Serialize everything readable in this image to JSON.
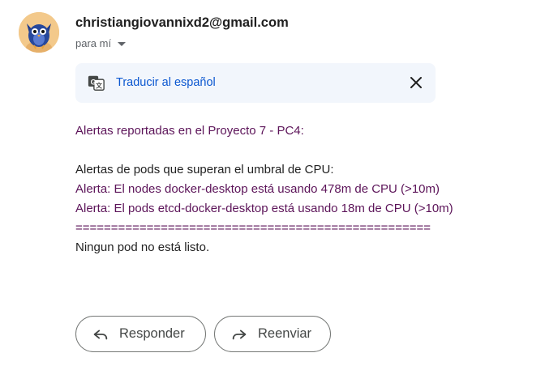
{
  "email": {
    "sender": "christiangiovannixd2@gmail.com",
    "recipient_label": "para mí"
  },
  "translate": {
    "label": "Traducir al español",
    "icon": "translate-icon",
    "close_icon": "close-icon"
  },
  "body": {
    "heading": "Alertas reportadas en el Proyecto 7 - PC4:",
    "subheading": "Alertas de pods que superan el umbral de CPU:",
    "alert1": "Alerta: El nodes docker-desktop está usando 478m de CPU (>10m)",
    "alert2": "Alerta: El pods etcd-docker-desktop está usando 18m de CPU (>10m)",
    "separator": "==================================================",
    "footer": "Ningun pod no está listo."
  },
  "actions": {
    "reply_label": "Responder",
    "forward_label": "Reenviar"
  },
  "colors": {
    "link": "#0b57d0",
    "body_purple": "#5c1459",
    "translate_bg": "#f2f6fc"
  }
}
